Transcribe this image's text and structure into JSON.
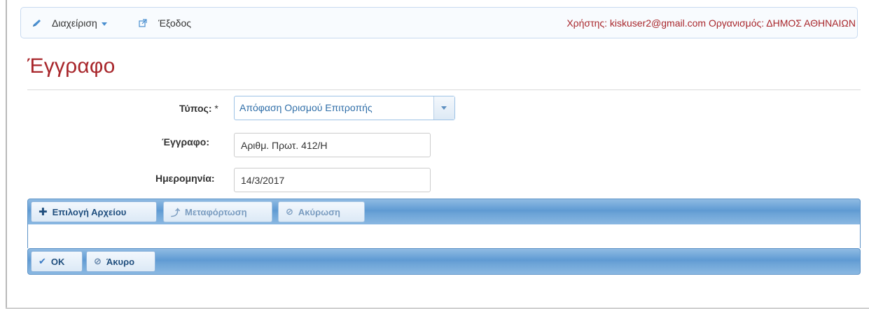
{
  "navbar": {
    "admin_label": "Διαχείριση",
    "exit_label": "Έξοδος",
    "user_info": "Χρήστης: kiskuser2@gmail.com Οργανισμός: ΔΗΜΟΣ ΑΘΗΝΑΙΩΝ"
  },
  "page": {
    "title": "Έγγραφο"
  },
  "form": {
    "type_label": "Τύπος:",
    "type_required": "*",
    "type_value": "Απόφαση Ορισμού Επιτροπής",
    "document_label": "Έγγραφο:",
    "document_value": "Αριθμ. Πρωτ. 412/Η",
    "date_label": "Ημερομηνία:",
    "date_value": "14/3/2017"
  },
  "upload_toolbar": {
    "select_file": "Επιλογή Αρχείου",
    "upload": "Μεταφόρτωση",
    "cancel": "Ακύρωση"
  },
  "action_toolbar": {
    "ok": "OK",
    "cancel": "Άκυρο"
  },
  "icons": {
    "admin": "pencil-icon",
    "exit": "external-link-icon",
    "select_file": "plus-icon",
    "upload": "upload-arrow-icon",
    "cancel": "cancel-circle-icon",
    "ok": "check-icon"
  },
  "colors": {
    "accent_red": "#a8262b",
    "toolbar_blue": "#6aa2d6",
    "link_blue": "#2f6ea8"
  }
}
